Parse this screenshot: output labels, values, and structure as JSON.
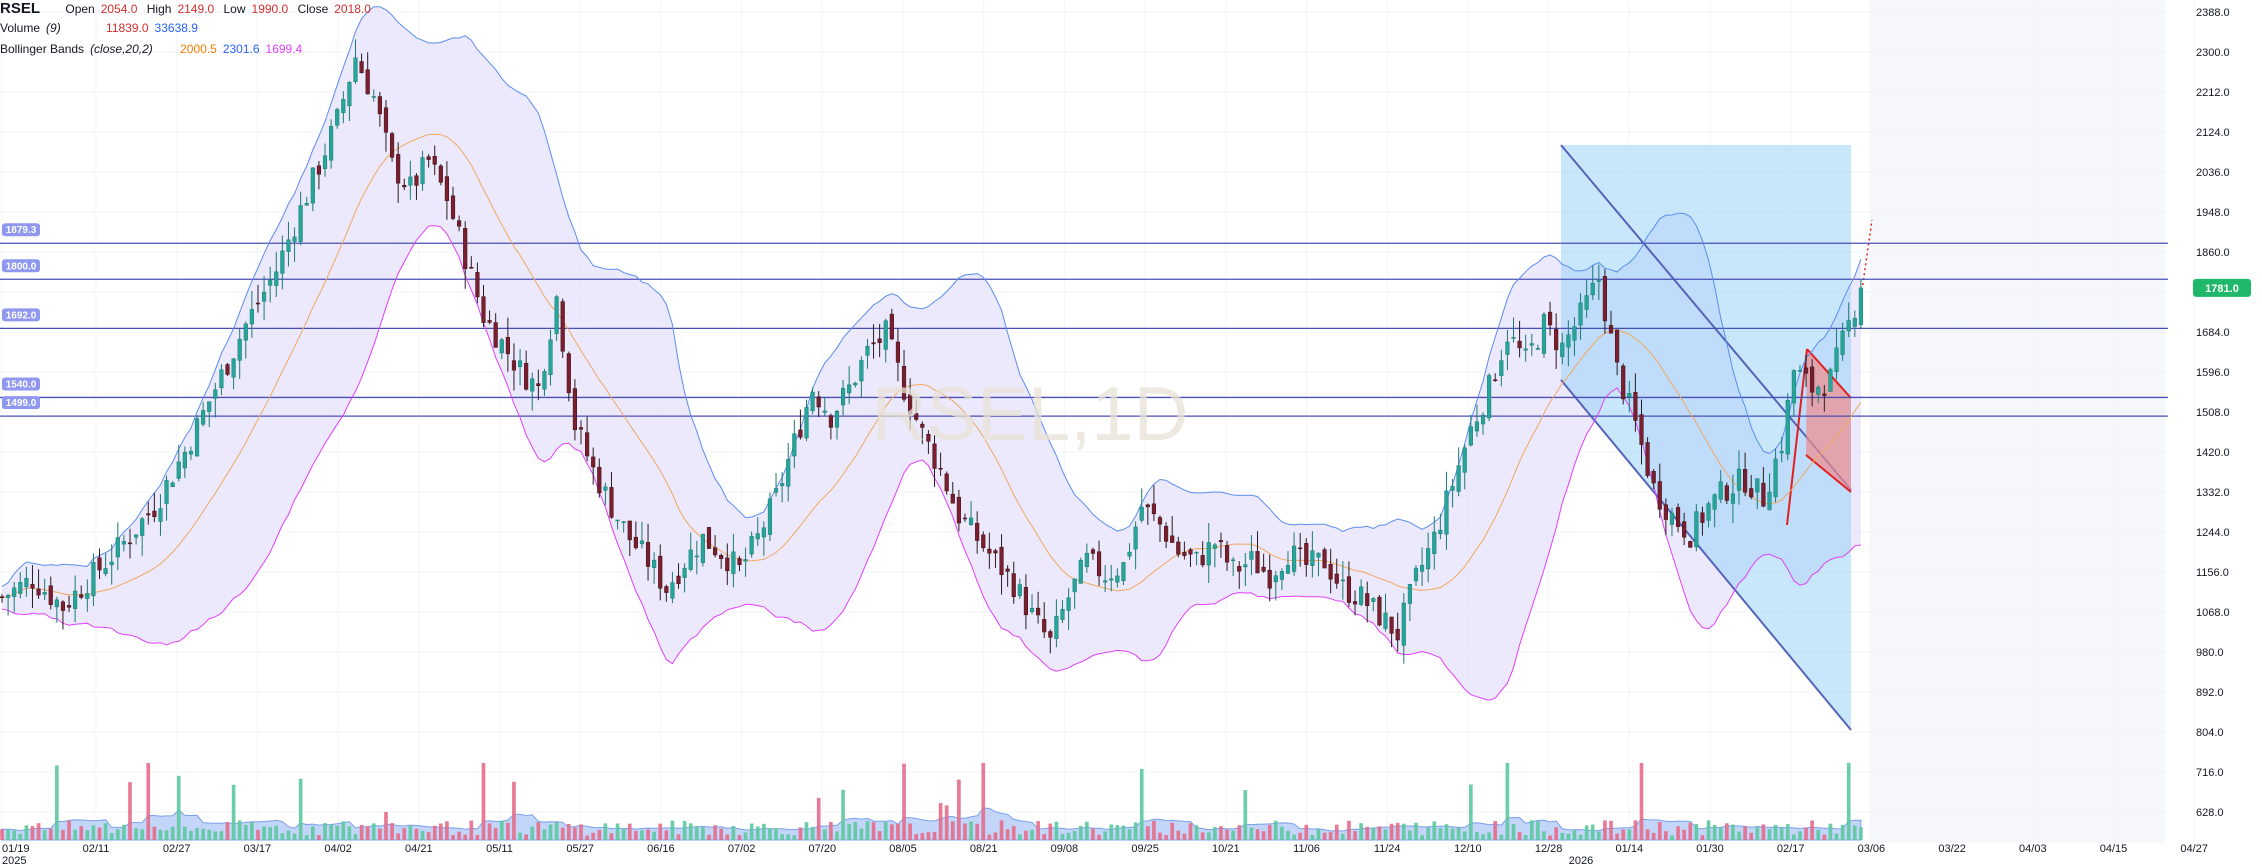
{
  "legend": {
    "symbol": "RSEL",
    "open_label": "Open",
    "open_value": "2054.0",
    "high_label": "High",
    "high_value": "2149.0",
    "low_label": "Low",
    "low_value": "1990.0",
    "close_label": "Close",
    "close_value": "2018.0",
    "volume_label": "Volume",
    "volume_param": "(9)",
    "volume_value": "11839.0",
    "volume_ma": "33638.9",
    "bb_label": "Bollinger Bands",
    "bb_param": "(close,20,2)",
    "bb_basis": "2000.5",
    "bb_upper": "2301.6",
    "bb_lower": "1699.4"
  },
  "watermark": "RSEL,1D",
  "colors": {
    "up": "#26a69a",
    "down": "#ef5350",
    "candle_body_down": "#7b1f2e",
    "bb_upper": "#5b8def",
    "bb_lower": "#e040fb",
    "bb_basis": "#f0a860",
    "bb_fill": "#e9e5fb",
    "level_line": "#4a4fb3",
    "channel_fill": "#9bd3f7",
    "wedge_fill": "#f08a8a",
    "wedge_line": "#e02020",
    "price_tag": "#1fb86b",
    "volume_ma_fill": "#aac3f5"
  },
  "chart_data": {
    "type": "candlestick",
    "price_axis": {
      "ticks": [
        "2388.0",
        "2300.0",
        "2212.0",
        "2124.0",
        "2036.0",
        "1948.0",
        "1860.0",
        "1772.0",
        "1684.0",
        "1596.0",
        "1508.0",
        "1420.0",
        "1332.0",
        "1244.0",
        "1156.0",
        "1068.0",
        "980.0",
        "892.0",
        "804.0",
        "716.0",
        "628.0"
      ],
      "range": [
        590,
        2420
      ]
    },
    "time_axis": {
      "ticks": [
        "01/19",
        "02/11",
        "02/27",
        "03/17",
        "04/02",
        "04/21",
        "05/11",
        "05/27",
        "06/16",
        "07/02",
        "07/20",
        "08/05",
        "08/21",
        "09/08",
        "09/25",
        "10/21",
        "11/06",
        "11/24",
        "12/10",
        "12/28",
        "01/14",
        "01/30",
        "02/17",
        "03/06",
        "03/22",
        "04/03",
        "04/15",
        "04/27"
      ],
      "year_labels": [
        "2025",
        "2026"
      ]
    },
    "horizontal_levels": [
      {
        "price": 1879.3,
        "label": "1879.3"
      },
      {
        "price": 1800.0,
        "label": "1800.0"
      },
      {
        "price": 1692.0,
        "label": "1692.0"
      },
      {
        "price": 1540.0,
        "label": "1540.0"
      },
      {
        "price": 1499.0,
        "label": "1499.0"
      }
    ],
    "last_price": {
      "value": 1781.0,
      "label": "1781.0"
    },
    "close_path": [
      [
        0,
        1100
      ],
      [
        5,
        1140
      ],
      [
        10,
        1080
      ],
      [
        15,
        1150
      ],
      [
        20,
        1220
      ],
      [
        25,
        1300
      ],
      [
        30,
        1420
      ],
      [
        35,
        1560
      ],
      [
        40,
        1700
      ],
      [
        45,
        1820
      ],
      [
        48,
        1920
      ],
      [
        52,
        2050
      ],
      [
        55,
        2150
      ],
      [
        58,
        2290
      ],
      [
        61,
        2200
      ],
      [
        64,
        2050
      ],
      [
        67,
        2000
      ],
      [
        70,
        2060
      ],
      [
        73,
        1980
      ],
      [
        76,
        1850
      ],
      [
        79,
        1720
      ],
      [
        82,
        1660
      ],
      [
        85,
        1600
      ],
      [
        88,
        1560
      ],
      [
        91,
        1760
      ],
      [
        94,
        1480
      ],
      [
        97,
        1380
      ],
      [
        100,
        1300
      ],
      [
        103,
        1230
      ],
      [
        106,
        1180
      ],
      [
        109,
        1120
      ],
      [
        112,
        1180
      ],
      [
        115,
        1230
      ],
      [
        118,
        1200
      ],
      [
        121,
        1160
      ],
      [
        124,
        1230
      ],
      [
        127,
        1320
      ],
      [
        130,
        1440
      ],
      [
        133,
        1560
      ],
      [
        136,
        1500
      ],
      [
        139,
        1560
      ],
      [
        142,
        1640
      ],
      [
        145,
        1680
      ],
      [
        148,
        1560
      ],
      [
        151,
        1460
      ],
      [
        154,
        1380
      ],
      [
        157,
        1280
      ],
      [
        160,
        1230
      ],
      [
        163,
        1180
      ],
      [
        166,
        1130
      ],
      [
        169,
        1060
      ],
      [
        172,
        1000
      ],
      [
        175,
        1100
      ],
      [
        178,
        1180
      ],
      [
        181,
        1150
      ],
      [
        184,
        1170
      ],
      [
        187,
        1300
      ],
      [
        190,
        1260
      ],
      [
        193,
        1200
      ],
      [
        196,
        1180
      ],
      [
        199,
        1220
      ],
      [
        202,
        1160
      ],
      [
        205,
        1180
      ],
      [
        208,
        1150
      ],
      [
        211,
        1200
      ],
      [
        214,
        1170
      ],
      [
        217,
        1180
      ],
      [
        220,
        1120
      ],
      [
        223,
        1100
      ],
      [
        226,
        1060
      ],
      [
        229,
        1020
      ],
      [
        232,
        1140
      ],
      [
        235,
        1230
      ],
      [
        238,
        1350
      ],
      [
        241,
        1470
      ],
      [
        244,
        1560
      ],
      [
        247,
        1680
      ],
      [
        250,
        1620
      ],
      [
        253,
        1700
      ],
      [
        256,
        1650
      ],
      [
        259,
        1720
      ],
      [
        262,
        1800
      ],
      [
        265,
        1600
      ],
      [
        268,
        1480
      ],
      [
        271,
        1340
      ],
      [
        274,
        1280
      ],
      [
        277,
        1240
      ],
      [
        280,
        1300
      ],
      [
        283,
        1340
      ],
      [
        286,
        1360
      ],
      [
        289,
        1320
      ],
      [
        292,
        1440
      ],
      [
        294,
        1600
      ],
      [
        297,
        1560
      ],
      [
        300,
        1580
      ],
      [
        303,
        1700
      ],
      [
        305,
        1781
      ]
    ]
  },
  "volume_chart": {
    "type": "bar",
    "series_name": "Volume",
    "ma_label": "Volume MA"
  }
}
